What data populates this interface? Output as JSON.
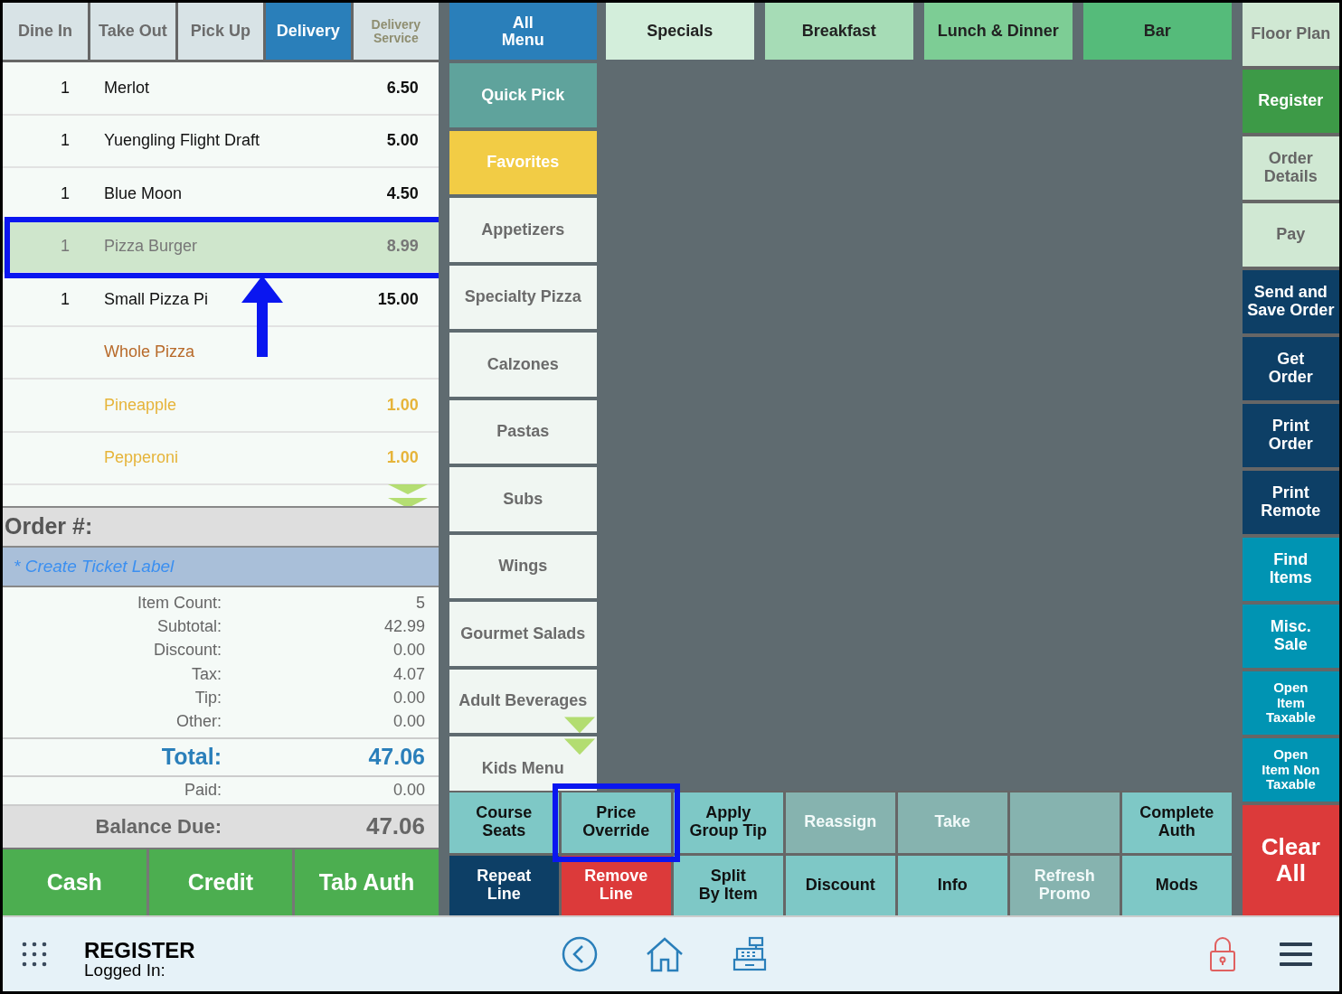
{
  "order_types": [
    {
      "label": "Dine In",
      "selected": false,
      "disabled": false
    },
    {
      "label": "Take Out",
      "selected": false,
      "disabled": false
    },
    {
      "label": "Pick Up",
      "selected": false,
      "disabled": false
    },
    {
      "label": "Delivery",
      "selected": true,
      "disabled": false
    },
    {
      "label": "Delivery\nService",
      "selected": false,
      "disabled": true
    }
  ],
  "order_lines": [
    {
      "qty": "1",
      "name": "Merlot",
      "price": "6.50",
      "kind": "item",
      "selected": false,
      "callout": false
    },
    {
      "qty": "1",
      "name": "Yuengling Flight Draft",
      "price": "5.00",
      "kind": "item",
      "selected": false,
      "callout": false
    },
    {
      "qty": "1",
      "name": "Blue Moon",
      "price": "4.50",
      "kind": "item",
      "selected": false,
      "callout": false
    },
    {
      "qty": "1",
      "name": "Pizza Burger",
      "price": "8.99",
      "kind": "item",
      "selected": true,
      "callout": true
    },
    {
      "qty": "1",
      "name": "Small Pizza Pi",
      "price": "15.00",
      "kind": "item",
      "selected": false,
      "callout": false
    },
    {
      "name": "Whole Pizza",
      "kind": "modifier",
      "selected": false,
      "callout": false
    },
    {
      "name": "Pineapple",
      "price": "1.00",
      "kind": "topping",
      "selected": false,
      "callout": false
    },
    {
      "name": "Pepperoni",
      "price": "1.00",
      "kind": "topping",
      "selected": false,
      "callout": false
    }
  ],
  "order": {
    "number_label": "Order #:",
    "ticket_label": "* Create Ticket Label"
  },
  "totals": [
    {
      "label": "Item Count:",
      "value": "5"
    },
    {
      "label": "Subtotal:",
      "value": "42.99"
    },
    {
      "label": "Discount:",
      "value": "0.00"
    },
    {
      "label": "Tax:",
      "value": "4.07"
    },
    {
      "label": "Tip:",
      "value": "0.00"
    },
    {
      "label": "Other:",
      "value": "0.00"
    }
  ],
  "total": {
    "label": "Total:",
    "value": "47.06"
  },
  "paid": {
    "label": "Paid:",
    "value": "0.00"
  },
  "balance_due": {
    "label": "Balance Due:",
    "value": "47.06"
  },
  "payment_buttons": [
    "Cash",
    "Credit",
    "Tab Auth"
  ],
  "menu_sections": [
    {
      "label": "All\nMenu",
      "kind": "all"
    },
    {
      "label": "Quick Pick",
      "kind": "quick"
    },
    {
      "label": "Favorites",
      "kind": "favorites"
    },
    {
      "label": "Appetizers",
      "kind": "category"
    },
    {
      "label": "Specialty Pizza",
      "kind": "category"
    },
    {
      "label": "Calzones",
      "kind": "category"
    },
    {
      "label": "Pastas",
      "kind": "category"
    },
    {
      "label": "Subs",
      "kind": "category"
    },
    {
      "label": "Wings",
      "kind": "category"
    },
    {
      "label": "Gourmet Salads",
      "kind": "category"
    },
    {
      "label": "Adult Beverages",
      "kind": "category"
    },
    {
      "label": "Kids Menu",
      "kind": "category"
    }
  ],
  "categories": [
    {
      "label": "Specials",
      "color": "#d3eedb"
    },
    {
      "label": "Breakfast",
      "color": "#a6dcb6"
    },
    {
      "label": "Lunch & Dinner",
      "color": "#7dcd95"
    },
    {
      "label": "Bar",
      "color": "#55bb7a"
    }
  ],
  "actions": [
    {
      "label": "Course\nSeats",
      "kind": "normal",
      "callout": false
    },
    {
      "label": "Price\nOverride",
      "kind": "normal",
      "callout": true
    },
    {
      "label": "Apply\nGroup Tip",
      "kind": "normal",
      "callout": false
    },
    {
      "label": "Reassign",
      "kind": "disabled",
      "callout": false
    },
    {
      "label": "Take",
      "kind": "disabled",
      "callout": false
    },
    {
      "kind": "disabled",
      "callout": false
    },
    {
      "label": "Complete\nAuth",
      "kind": "normal",
      "callout": false
    },
    {
      "label": "Repeat\nLine",
      "kind": "dark",
      "callout": false
    },
    {
      "label": "Remove\nLine",
      "kind": "danger",
      "callout": false
    },
    {
      "label": "Split\nBy Item",
      "kind": "normal",
      "callout": false
    },
    {
      "label": "Discount",
      "kind": "normal",
      "callout": false
    },
    {
      "label": "Info",
      "kind": "normal",
      "callout": false
    },
    {
      "label": "Refresh\nPromo",
      "kind": "disabled",
      "callout": false
    },
    {
      "label": "Mods",
      "kind": "normal",
      "callout": false
    }
  ],
  "side_buttons": [
    {
      "label": "Floor Plan",
      "kind": "light"
    },
    {
      "label": "Register",
      "kind": "active"
    },
    {
      "label": "Order\nDetails",
      "kind": "light"
    },
    {
      "label": "Pay",
      "kind": "light"
    },
    {
      "label": "Send and\nSave Order",
      "kind": "navy"
    },
    {
      "label": "Get\nOrder",
      "kind": "navy"
    },
    {
      "label": "Print\nOrder",
      "kind": "navy"
    },
    {
      "label": "Print\nRemote",
      "kind": "navy"
    },
    {
      "label": "Find\nItems",
      "kind": "cyan"
    },
    {
      "label": "Misc.\nSale",
      "kind": "cyan"
    },
    {
      "label": "Open\nItem\nTaxable",
      "kind": "cyan-small"
    },
    {
      "label": "Open\nItem Non\nTaxable",
      "kind": "cyan-small"
    },
    {
      "label": "Clear\nAll",
      "kind": "danger"
    }
  ],
  "footer": {
    "title": "REGISTER",
    "subtitle": "Logged In:"
  }
}
